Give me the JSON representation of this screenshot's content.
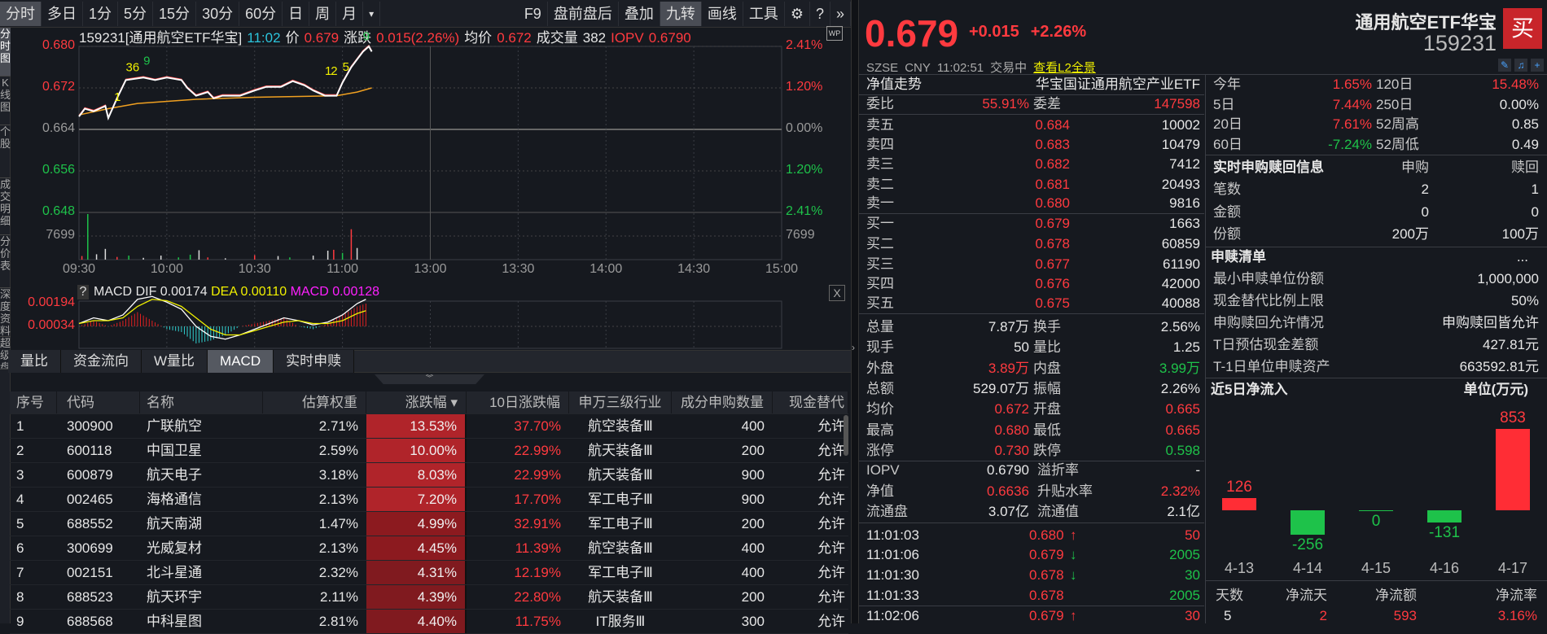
{
  "left_strip": [
    "分时图",
    "K线图",
    "个股",
    "成交明细",
    "分价表",
    "深度资料",
    "超级盘口"
  ],
  "toolbar": {
    "left": [
      "分时",
      "多日",
      "1分",
      "5分",
      "15分",
      "30分",
      "60分",
      "日",
      "周",
      "月"
    ],
    "more": "▾",
    "right": [
      "F9",
      "盘前盘后",
      "叠加",
      "九转",
      "画线",
      "工具"
    ],
    "active_left": "分时",
    "active_right": "九转"
  },
  "info": {
    "title": "159231[通用航空ETF华宝]",
    "time": "11:02",
    "price_label": "价",
    "price": "0.679",
    "change_label": "涨跌",
    "change": "0.015(2.26%)",
    "avg_label": "均价",
    "avg": "0.672",
    "vol_label": "成交量",
    "vol": "382",
    "iopv_label": "IOPV",
    "iopv": "0.6790",
    "wp": "WP"
  },
  "price_chart": {
    "left_axis": [
      "0.680",
      "0.672",
      "0.664",
      "0.656",
      "0.648"
    ],
    "right_axis": [
      "2.41%",
      "1.20%",
      "0.00%",
      "1.20%",
      "2.41%"
    ],
    "vol_axis": "7699",
    "times": [
      "09:30",
      "10:00",
      "10:30",
      "11:00",
      "13:00",
      "13:30",
      "14:00",
      "14:30",
      "15:00"
    ],
    "ylim": [
      0.648,
      0.68
    ],
    "price_series": [
      [
        0,
        0.6665
      ],
      [
        2,
        0.668
      ],
      [
        5,
        0.6675
      ],
      [
        9,
        0.6685
      ],
      [
        10,
        0.6662
      ],
      [
        13,
        0.67
      ],
      [
        16,
        0.6735
      ],
      [
        22,
        0.674
      ],
      [
        26,
        0.6735
      ],
      [
        30,
        0.674
      ],
      [
        35,
        0.6735
      ],
      [
        37,
        0.672
      ],
      [
        40,
        0.6705
      ],
      [
        44,
        0.6712
      ],
      [
        46,
        0.67
      ],
      [
        49,
        0.6705
      ],
      [
        55,
        0.6705
      ],
      [
        60,
        0.6715
      ],
      [
        64,
        0.6722
      ],
      [
        69,
        0.6722
      ],
      [
        73,
        0.6733
      ],
      [
        77,
        0.6725
      ],
      [
        80,
        0.6715
      ],
      [
        84,
        0.6705
      ],
      [
        88,
        0.6705
      ],
      [
        90,
        0.673
      ],
      [
        93,
        0.676
      ],
      [
        95,
        0.6775
      ],
      [
        97,
        0.679
      ],
      [
        99,
        0.68
      ],
      [
        100,
        0.679
      ]
    ],
    "avg_series": [
      [
        0,
        0.6668
      ],
      [
        10,
        0.668
      ],
      [
        20,
        0.669
      ],
      [
        40,
        0.6698
      ],
      [
        60,
        0.6702
      ],
      [
        88,
        0.6705
      ],
      [
        95,
        0.6712
      ],
      [
        100,
        0.672
      ]
    ],
    "nine_turn": [
      {
        "m": 12,
        "p": 0.6695,
        "t": "1",
        "c": "#f0f000"
      },
      {
        "m": 16,
        "p": 0.6752,
        "t": "36",
        "c": "#f0f000"
      },
      {
        "m": 22,
        "p": 0.6765,
        "t": "9",
        "c": "#1ec24a"
      },
      {
        "m": 84,
        "p": 0.6745,
        "t": "1",
        "c": "#f0f000"
      },
      {
        "m": 86,
        "p": 0.6745,
        "t": "2",
        "c": "#f0f000"
      },
      {
        "m": 90,
        "p": 0.6753,
        "t": "5",
        "c": "#f0f000"
      },
      {
        "m": 97,
        "p": 0.6812,
        "t": "9",
        "c": "#1ec24a"
      }
    ],
    "volumes": [
      [
        1,
        800,
        "r"
      ],
      [
        3,
        10200,
        "g"
      ],
      [
        6,
        1200,
        "w"
      ],
      [
        9,
        2400,
        "w"
      ],
      [
        13,
        600,
        "r"
      ],
      [
        17,
        900,
        "g"
      ],
      [
        22,
        400,
        "w"
      ],
      [
        28,
        900,
        "w"
      ],
      [
        34,
        500,
        "g"
      ],
      [
        38,
        1100,
        "g"
      ],
      [
        41,
        2100,
        "w"
      ],
      [
        44,
        500,
        "r"
      ],
      [
        50,
        300,
        "w"
      ],
      [
        60,
        1000,
        "r"
      ],
      [
        68,
        800,
        "w"
      ],
      [
        72,
        500,
        "g"
      ],
      [
        80,
        900,
        "w"
      ],
      [
        85,
        2000,
        "w"
      ],
      [
        87,
        2200,
        "r"
      ],
      [
        90,
        1500,
        "g"
      ],
      [
        93,
        6800,
        "r"
      ],
      [
        95,
        2600,
        "w"
      ]
    ]
  },
  "macd": {
    "help": "?",
    "name": "MACD",
    "dif_label": "DIF 0.00174",
    "dea_label": "DEA 0.00110",
    "macd_label": "MACD 0.00128",
    "axis": [
      "0.00194",
      "0.00034"
    ],
    "close": "X",
    "dif": [
      [
        0,
        0.0002
      ],
      [
        5,
        0.0006
      ],
      [
        10,
        0.0004
      ],
      [
        15,
        0.0008
      ],
      [
        20,
        0.0019
      ],
      [
        25,
        0.0021
      ],
      [
        30,
        0.0017
      ],
      [
        35,
        0.0012
      ],
      [
        40,
        0.0
      ],
      [
        45,
        -0.0007
      ],
      [
        50,
        -0.0009
      ],
      [
        55,
        -0.0006
      ],
      [
        60,
        -0.0002
      ],
      [
        65,
        0.0002
      ],
      [
        70,
        0.0006
      ],
      [
        75,
        0.0004
      ],
      [
        80,
        0.0001
      ],
      [
        85,
        0.0003
      ],
      [
        90,
        0.0008
      ],
      [
        95,
        0.0016
      ],
      [
        98,
        0.0019
      ]
    ],
    "dea": [
      [
        0,
        0.0002
      ],
      [
        5,
        0.0004
      ],
      [
        10,
        0.0004
      ],
      [
        15,
        0.0006
      ],
      [
        20,
        0.0014
      ],
      [
        25,
        0.0019
      ],
      [
        30,
        0.0018
      ],
      [
        35,
        0.0014
      ],
      [
        40,
        0.0006
      ],
      [
        45,
        -0.0002
      ],
      [
        50,
        -0.0006
      ],
      [
        55,
        -0.0006
      ],
      [
        60,
        -0.0003
      ],
      [
        65,
        0.0
      ],
      [
        70,
        0.0003
      ],
      [
        75,
        0.0004
      ],
      [
        80,
        0.0002
      ],
      [
        85,
        0.0002
      ],
      [
        90,
        0.0004
      ],
      [
        95,
        0.0009
      ],
      [
        98,
        0.0011
      ]
    ]
  },
  "tabs": [
    "量比",
    "资金流向",
    "W量比",
    "MACD",
    "实时申赎"
  ],
  "tabs_active": "MACD",
  "expand": "︾",
  "table": {
    "headers": [
      "序号",
      "代码",
      "名称",
      "估算权重",
      "涨跌幅 ▾",
      "10日涨跌幅",
      "申万三级行业",
      "成分申购数量",
      "现金替代"
    ],
    "rows": [
      [
        "1",
        "300900",
        "广联航空",
        "2.71%",
        "13.53%",
        "37.70%",
        "航空装备Ⅲ",
        "400",
        "允许"
      ],
      [
        "2",
        "600118",
        "中国卫星",
        "2.59%",
        "10.00%",
        "22.99%",
        "航天装备Ⅲ",
        "200",
        "允许"
      ],
      [
        "3",
        "600879",
        "航天电子",
        "3.18%",
        "8.03%",
        "22.99%",
        "航天装备Ⅲ",
        "900",
        "允许"
      ],
      [
        "4",
        "002465",
        "海格通信",
        "2.13%",
        "7.20%",
        "17.70%",
        "军工电子Ⅲ",
        "900",
        "允许"
      ],
      [
        "5",
        "688552",
        "航天南湖",
        "1.47%",
        "4.99%",
        "32.91%",
        "军工电子Ⅲ",
        "200",
        "允许"
      ],
      [
        "6",
        "300699",
        "光威复材",
        "2.13%",
        "4.45%",
        "11.39%",
        "航空装备Ⅲ",
        "400",
        "允许"
      ],
      [
        "7",
        "002151",
        "北斗星通",
        "2.32%",
        "4.31%",
        "12.19%",
        "军工电子Ⅲ",
        "400",
        "允许"
      ],
      [
        "8",
        "688523",
        "航天环宇",
        "2.11%",
        "4.39%",
        "22.80%",
        "航天装备Ⅲ",
        "200",
        "允许"
      ],
      [
        "9",
        "688568",
        "中科星图",
        "2.81%",
        "4.40%",
        "11.75%",
        "IT服务Ⅲ",
        "300",
        "允许"
      ]
    ]
  },
  "quote": {
    "price": "0.679",
    "change": "+0.015",
    "change_pct": "+2.26%",
    "name": "通用航空ETF华宝",
    "code": "159231",
    "buy": "买",
    "exchange": "SZSE",
    "currency": "CNY",
    "time": "11:02:51",
    "status": "交易中",
    "l2_link": "查看L2全景"
  },
  "book": {
    "nav_label": "净值走势",
    "fund_name": "华宝国证通用航空产业ETF",
    "wb_label": "委比",
    "wb": "55.91%",
    "wc_label": "委差",
    "wc": "147598",
    "asks": [
      [
        "卖五",
        "0.684",
        "10002"
      ],
      [
        "卖四",
        "0.683",
        "10479"
      ],
      [
        "卖三",
        "0.682",
        "7412"
      ],
      [
        "卖二",
        "0.681",
        "20493"
      ],
      [
        "卖一",
        "0.680",
        "9816"
      ]
    ],
    "bids": [
      [
        "买一",
        "0.679",
        "1663"
      ],
      [
        "买二",
        "0.678",
        "60859"
      ],
      [
        "买三",
        "0.677",
        "61190"
      ],
      [
        "买四",
        "0.676",
        "42000"
      ],
      [
        "买五",
        "0.675",
        "40088"
      ]
    ]
  },
  "stats": [
    [
      "总量",
      "7.87万",
      "w",
      "换手",
      "2.56%",
      "w"
    ],
    [
      "现手",
      "50",
      "w",
      "量比",
      "1.25",
      "w"
    ],
    [
      "外盘",
      "3.89万",
      "r",
      "内盘",
      "3.99万",
      "g"
    ],
    [
      "总额",
      "529.07万",
      "w",
      "振幅",
      "2.26%",
      "w"
    ],
    [
      "均价",
      "0.672",
      "r",
      "开盘",
      "0.665",
      "r"
    ],
    [
      "最高",
      "0.680",
      "r",
      "最低",
      "0.665",
      "r"
    ],
    [
      "涨停",
      "0.730",
      "r",
      "跌停",
      "0.598",
      "g"
    ]
  ],
  "etf_stats": [
    [
      "IOPV",
      "0.6790",
      "w",
      "溢折率",
      "-",
      "w"
    ],
    [
      "净值",
      "0.6636",
      "r",
      "升贴水率",
      "2.32%",
      "r"
    ],
    [
      "流通盘",
      "3.07亿",
      "w",
      "流通值",
      "2.1亿",
      "w"
    ]
  ],
  "trades": [
    [
      "11:01:03",
      "0.680",
      "up",
      "50",
      "r"
    ],
    [
      "11:01:06",
      "0.679",
      "down",
      "2005",
      "g"
    ],
    [
      "11:01:30",
      "0.678",
      "down",
      "30",
      "g"
    ],
    [
      "11:01:33",
      "0.678",
      "",
      "2005",
      "g"
    ],
    [
      "11:02:06",
      "0.679",
      "up",
      "30",
      "r"
    ]
  ],
  "returns": [
    [
      "今年",
      "1.65%",
      "r",
      "120日",
      "15.48%",
      "r"
    ],
    [
      "5日",
      "7.44%",
      "r",
      "250日",
      "0.00%",
      "w"
    ],
    [
      "20日",
      "7.61%",
      "r",
      "52周高",
      "0.85",
      "w"
    ],
    [
      "60日",
      "-7.24%",
      "g",
      "52周低",
      "0.49",
      "w"
    ]
  ],
  "creation": {
    "title": "实时申购赎回信息",
    "col1": "申购",
    "col2": "赎回",
    "rows": [
      [
        "笔数",
        "2",
        "1"
      ],
      [
        "金额",
        "0",
        "0"
      ],
      [
        "份额",
        "200万",
        "100万"
      ]
    ]
  },
  "pcf": {
    "title": "申赎清单",
    "more": "...",
    "rows": [
      [
        "最小申赎单位份额",
        "1,000,000"
      ],
      [
        "现金替代比例上限",
        "50%"
      ],
      [
        "申购赎回允许情况",
        "申购赎回皆允许"
      ],
      [
        "T日预估现金差额",
        "427.81元"
      ],
      [
        "T-1日单位申赎资产",
        "663592.81元"
      ]
    ]
  },
  "chart_data": {
    "type": "bar",
    "title": "近5日净流入",
    "unit": "单位(万元)",
    "categories": [
      "4-13",
      "4-14",
      "4-15",
      "4-16",
      "4-17"
    ],
    "values": [
      126,
      -256,
      0,
      -131,
      853
    ],
    "value_labels": [
      "126",
      "-256",
      "0",
      "-131",
      "853"
    ]
  },
  "flow_summary": {
    "headers": [
      "天数",
      "净流天",
      "净流额",
      "净流率"
    ],
    "values": [
      "5",
      "2",
      "593",
      "3.16%"
    ]
  },
  "colors": {
    "up": "#ff3a3f",
    "down": "#1ec24a",
    "bg": "#16191f"
  }
}
